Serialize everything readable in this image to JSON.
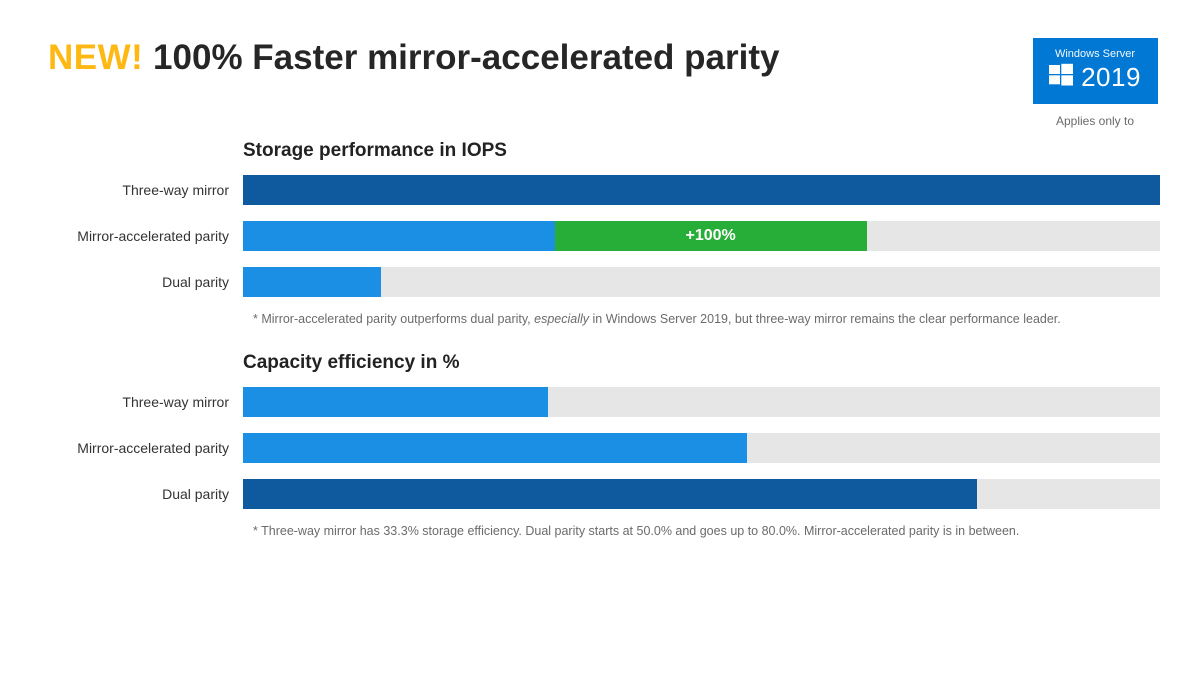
{
  "header": {
    "new_label": "NEW!",
    "title_rest": "100% Faster mirror-accelerated parity",
    "badge_top": "Windows Server",
    "badge_year": "2019",
    "applies": "Applies only to"
  },
  "chart_data": [
    {
      "type": "bar",
      "orientation": "horizontal",
      "title": "Storage performance in IOPS",
      "xlim": [
        0,
        100
      ],
      "series": [
        {
          "name": "Three-way mirror",
          "segments": [
            {
              "value": 100,
              "color": "#0f5a9e"
            }
          ]
        },
        {
          "name": "Mirror-accelerated parity",
          "segments": [
            {
              "value": 34,
              "color": "#1a8fe3"
            },
            {
              "value": 34,
              "color": "#27ae38",
              "label": "+100%"
            }
          ]
        },
        {
          "name": "Dual parity",
          "segments": [
            {
              "value": 15,
              "color": "#1a8fe3"
            }
          ]
        }
      ],
      "footnote_pre": "* Mirror-accelerated parity outperforms dual parity, ",
      "footnote_em": "especially",
      "footnote_post": " in Windows Server 2019, but three-way mirror remains the clear performance leader."
    },
    {
      "type": "bar",
      "orientation": "horizontal",
      "title": "Capacity efficiency in %",
      "xlim": [
        0,
        100
      ],
      "series": [
        {
          "name": "Three-way mirror",
          "segments": [
            {
              "value": 33.3,
              "color": "#1a8fe3"
            }
          ]
        },
        {
          "name": "Mirror-accelerated parity",
          "segments": [
            {
              "value": 55,
              "color": "#1a8fe3"
            }
          ]
        },
        {
          "name": "Dual parity",
          "segments": [
            {
              "value": 80,
              "color": "#0f5a9e"
            }
          ]
        }
      ],
      "footnote_pre": "* Three-way mirror has 33.3% storage efficiency. Dual parity starts at 50.0% and goes up to 80.0%. Mirror-accelerated parity is in between.",
      "footnote_em": "",
      "footnote_post": ""
    }
  ],
  "colors": {
    "accent_yellow": "#fdb813",
    "ms_blue": "#0078d4",
    "bar_dark": "#0f5a9e",
    "bar_light": "#1a8fe3",
    "bar_green": "#27ae38",
    "track": "#e6e6e6"
  }
}
